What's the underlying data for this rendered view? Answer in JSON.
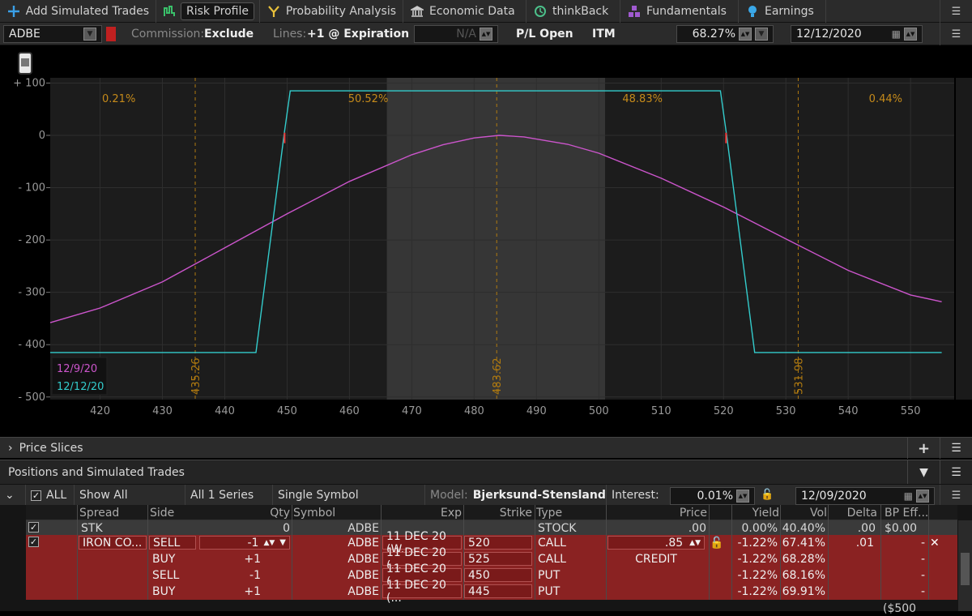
{
  "tabs": [
    {
      "label": "Add Simulated Trades",
      "icon": "plus-icon"
    },
    {
      "label": "Risk Profile",
      "icon": "risk-profile-icon",
      "active": true
    },
    {
      "label": "Probability Analysis",
      "icon": "probability-icon"
    },
    {
      "label": "Economic Data",
      "icon": "bank-icon"
    },
    {
      "label": "thinkBack",
      "icon": "clock-icon"
    },
    {
      "label": "Fundamentals",
      "icon": "blocks-icon"
    },
    {
      "label": "Earnings",
      "icon": "bulb-icon"
    }
  ],
  "controls": {
    "symbol": "ADBE",
    "commission_label": "Commission:",
    "commission_value": "Exclude",
    "lines_label": "Lines:",
    "lines_value": "+1 @ Expiration",
    "na_value": "N/A",
    "pl_mode": "P/L Open",
    "itm": "ITM",
    "probability": "68.27%",
    "date": "12/12/2020"
  },
  "chart_data": {
    "type": "line",
    "x_ticks": [
      420,
      430,
      440,
      450,
      460,
      470,
      480,
      490,
      500,
      510,
      520,
      530,
      540,
      550
    ],
    "y_ticks": [
      100,
      0,
      -100,
      -200,
      -300,
      -400,
      -500
    ],
    "y_tick_labels": [
      "+ 100",
      "0",
      "- 100",
      "- 200",
      "- 300",
      "- 400",
      "- 500"
    ],
    "xlim": [
      412,
      557
    ],
    "ylim": [
      -505,
      110
    ],
    "shaded_band": [
      466,
      501
    ],
    "prob_labels": [
      {
        "text": "0.21%",
        "x": 423
      },
      {
        "text": "50.52%",
        "x": 463
      },
      {
        "text": "48.83%",
        "x": 507
      },
      {
        "text": "0.44%",
        "x": 546
      }
    ],
    "vlines": [
      {
        "x": 435.26,
        "label": "435.26"
      },
      {
        "x": 483.62,
        "label": "483.62"
      },
      {
        "x": 531.98,
        "label": "531.98"
      }
    ],
    "series": [
      {
        "name": "12/9/20",
        "color": "#cc55cc",
        "x": [
          412,
          420,
          430,
          440,
          450,
          460,
          470,
          475,
          480,
          484,
          488,
          495,
          500,
          510,
          520,
          530,
          540,
          550,
          555
        ],
        "y": [
          -358,
          -330,
          -280,
          -215,
          -150,
          -88,
          -37,
          -18,
          -5,
          0,
          -3,
          -17,
          -34,
          -82,
          -137,
          -198,
          -258,
          -305,
          -318
        ]
      },
      {
        "name": "12/12/20",
        "color": "#33cccc",
        "x": [
          412,
          445,
          449.5,
          450.5,
          519.5,
          520.5,
          525,
          555
        ],
        "y": [
          -415,
          -415,
          0,
          85,
          85,
          0,
          -415,
          -415
        ]
      }
    ]
  },
  "sections": {
    "price_slices": "Price Slices",
    "positions": "Positions and Simulated Trades"
  },
  "filters": {
    "all": "ALL",
    "show": "Show All",
    "series": "All 1 Series",
    "symbol_mode": "Single Symbol",
    "model_label": "Model:",
    "model_value": "Bjerksund-Stensland",
    "interest_label": "Interest:",
    "interest_value": "0.01%",
    "date": "12/09/2020"
  },
  "columns": [
    "Spread",
    "Side",
    "Qty",
    "Symbol",
    "Exp",
    "Strike",
    "Type",
    "Price",
    "Yield",
    "Vol",
    "Delta",
    "BP Eff..."
  ],
  "stk_row": {
    "spread": "STK",
    "qty": "0",
    "symbol": "ADBE",
    "type": "STOCK",
    "price": ".00",
    "yield": "0.00%",
    "vol": "40.40%",
    "delta": ".00",
    "bp": "$0.00"
  },
  "legs": [
    {
      "spread": "IRON CO...",
      "side": "SELL",
      "qty": "-1",
      "symbol": "ADBE",
      "exp": "11 DEC 20 (W...",
      "strike": "520",
      "type": "CALL",
      "price": ".85",
      "yield": "-1.22%",
      "vol": "67.41%",
      "delta": ".01",
      "bp": "-"
    },
    {
      "spread": "",
      "side": "BUY",
      "qty": "+1",
      "symbol": "ADBE",
      "exp": "11 DEC 20 (...",
      "strike": "525",
      "type": "CALL",
      "price": "CREDIT",
      "yield": "-1.22%",
      "vol": "68.28%",
      "delta": "",
      "bp": "-"
    },
    {
      "spread": "",
      "side": "SELL",
      "qty": "-1",
      "symbol": "ADBE",
      "exp": "11 DEC 20 (...",
      "strike": "450",
      "type": "PUT",
      "price": "",
      "yield": "-1.22%",
      "vol": "68.16%",
      "delta": "",
      "bp": "-"
    },
    {
      "spread": "",
      "side": "BUY",
      "qty": "+1",
      "symbol": "ADBE",
      "exp": "11 DEC 20 (...",
      "strike": "445",
      "type": "PUT",
      "price": "",
      "yield": "-1.22%",
      "vol": "69.91%",
      "delta": "",
      "bp": "-"
    }
  ],
  "footer_bp": "($500"
}
